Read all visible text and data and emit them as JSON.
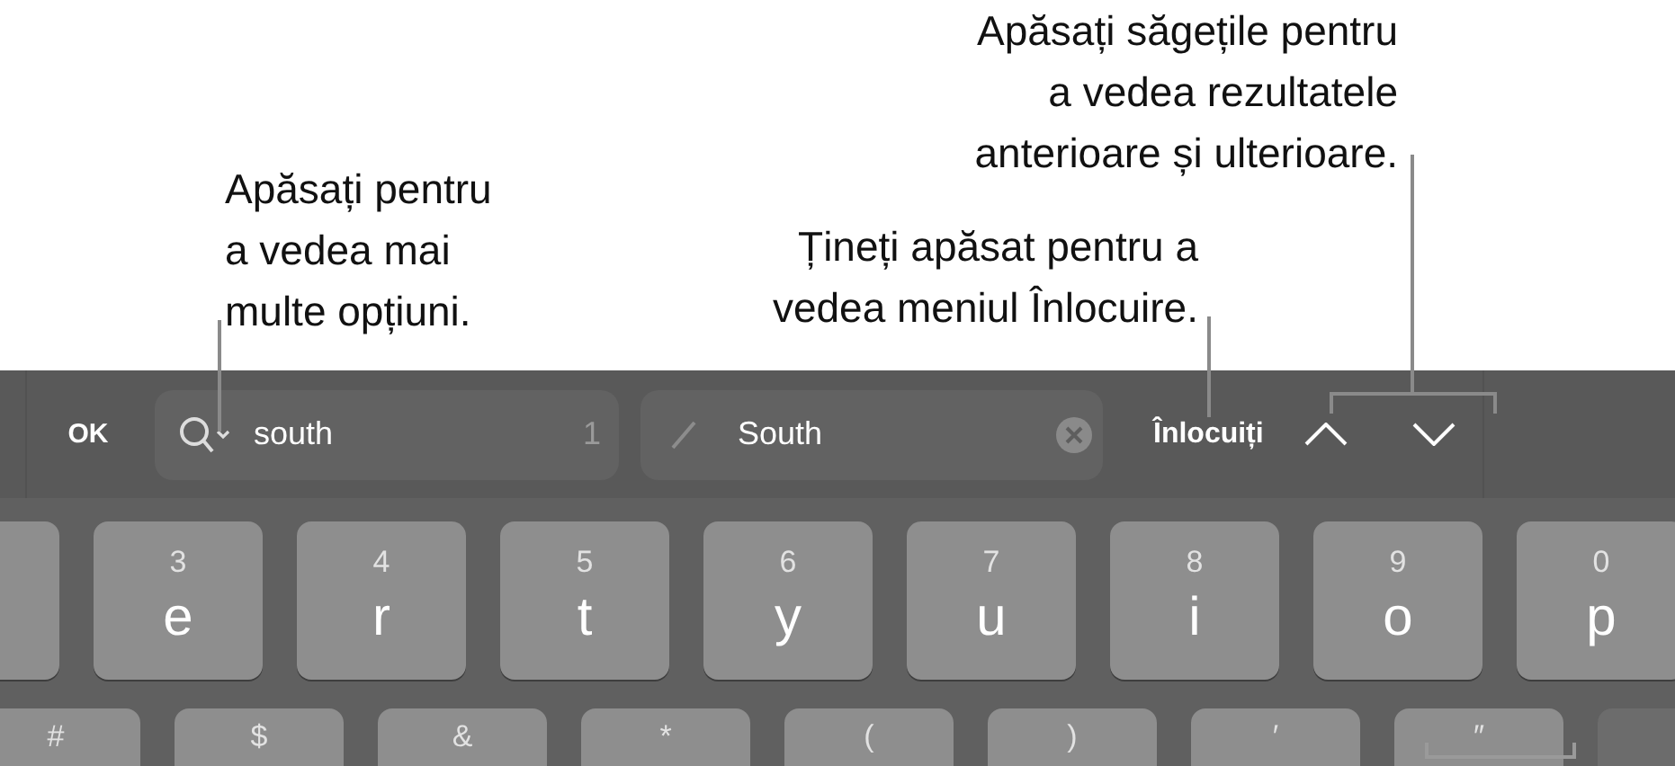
{
  "callouts": [
    {
      "lines": [
        "Apăsați pentru",
        "a vedea mai",
        "multe opțiuni."
      ]
    },
    {
      "lines": [
        "Țineți apăsat pentru a",
        "vedea meniul Înlocuire."
      ]
    },
    {
      "lines": [
        "Apăsați săgețile pentru",
        "a vedea rezultatele",
        "anterioare și ulterioare."
      ]
    }
  ],
  "find_bar": {
    "done_button": "OK",
    "search_field": {
      "value": "south",
      "match_count": "1"
    },
    "replace_field": {
      "value": "South"
    },
    "replace_button": "Înlocuiți"
  },
  "keyboard": {
    "rows": [
      [
        {
          "kind": "blank"
        },
        {
          "kind": "letter",
          "label": "e",
          "alt": "3"
        },
        {
          "kind": "letter",
          "label": "r",
          "alt": "4"
        },
        {
          "kind": "letter",
          "label": "t",
          "alt": "5"
        },
        {
          "kind": "letter",
          "label": "y",
          "alt": "6"
        },
        {
          "kind": "letter",
          "label": "u",
          "alt": "7"
        },
        {
          "kind": "letter",
          "label": "i",
          "alt": "8"
        },
        {
          "kind": "letter",
          "label": "o",
          "alt": "9"
        },
        {
          "kind": "letter",
          "label": "p",
          "alt": "0"
        }
      ],
      [
        {
          "kind": "symbol",
          "label": "#"
        },
        {
          "kind": "symbol",
          "label": "$"
        },
        {
          "kind": "symbol",
          "label": "&"
        },
        {
          "kind": "symbol",
          "label": "*"
        },
        {
          "kind": "symbol",
          "label": "("
        },
        {
          "kind": "symbol",
          "label": ")"
        },
        {
          "kind": "symbol",
          "label": "′"
        },
        {
          "kind": "symbol",
          "label": "″"
        },
        {
          "kind": "dark"
        }
      ]
    ]
  }
}
